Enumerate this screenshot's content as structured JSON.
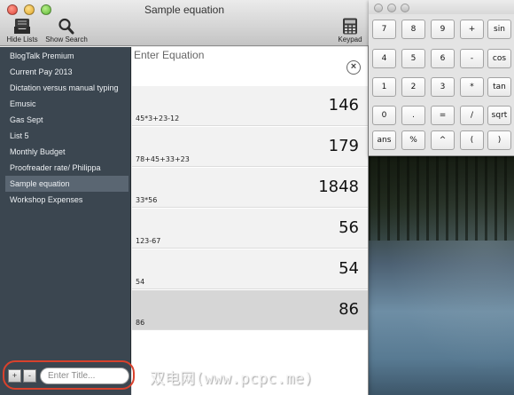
{
  "window": {
    "title": "Sample equation",
    "toolbar": {
      "hide_lists": "Hide Lists",
      "show_search": "Show Search",
      "keypad": "Keypad"
    }
  },
  "sidebar": {
    "items": [
      {
        "label": "BlogTalk Premium"
      },
      {
        "label": "Current Pay 2013"
      },
      {
        "label": "Dictation versus manual typing"
      },
      {
        "label": "Emusic"
      },
      {
        "label": "Gas Sept"
      },
      {
        "label": "List 5"
      },
      {
        "label": "Monthly Budget"
      },
      {
        "label": "Proofreader rate/ Philippa"
      },
      {
        "label": "Sample equation",
        "selected": true
      },
      {
        "label": "Workshop Expenses"
      }
    ],
    "add_label": "+",
    "remove_label": "-",
    "title_placeholder": "Enter Title..."
  },
  "editor": {
    "equation_placeholder": "Enter Equation",
    "clear_icon": "clear-circle-icon",
    "rows": [
      {
        "expression": "45*3+23-12",
        "result": "146"
      },
      {
        "expression": "78+45+33+23",
        "result": "179"
      },
      {
        "expression": "33*56",
        "result": "1848"
      },
      {
        "expression": "123-67",
        "result": "56"
      },
      {
        "expression": "54",
        "result": "54"
      },
      {
        "expression": "86",
        "result": "86",
        "active": true
      }
    ]
  },
  "keypad": {
    "keys": [
      [
        "7",
        "8",
        "9",
        "+",
        "sin"
      ],
      [
        "4",
        "5",
        "6",
        "-",
        "cos"
      ],
      [
        "1",
        "2",
        "3",
        "*",
        "tan"
      ],
      [
        "0",
        ".",
        "=",
        "/",
        "sqrt"
      ],
      [
        "ans",
        "%",
        "^",
        "(",
        ")"
      ]
    ]
  },
  "watermark": "双电网(www.pcpc.me)",
  "colors": {
    "sidebar_bg": "#3b4650",
    "sidebar_selected": "#5a6672",
    "highlight_ring": "#d9412c"
  }
}
